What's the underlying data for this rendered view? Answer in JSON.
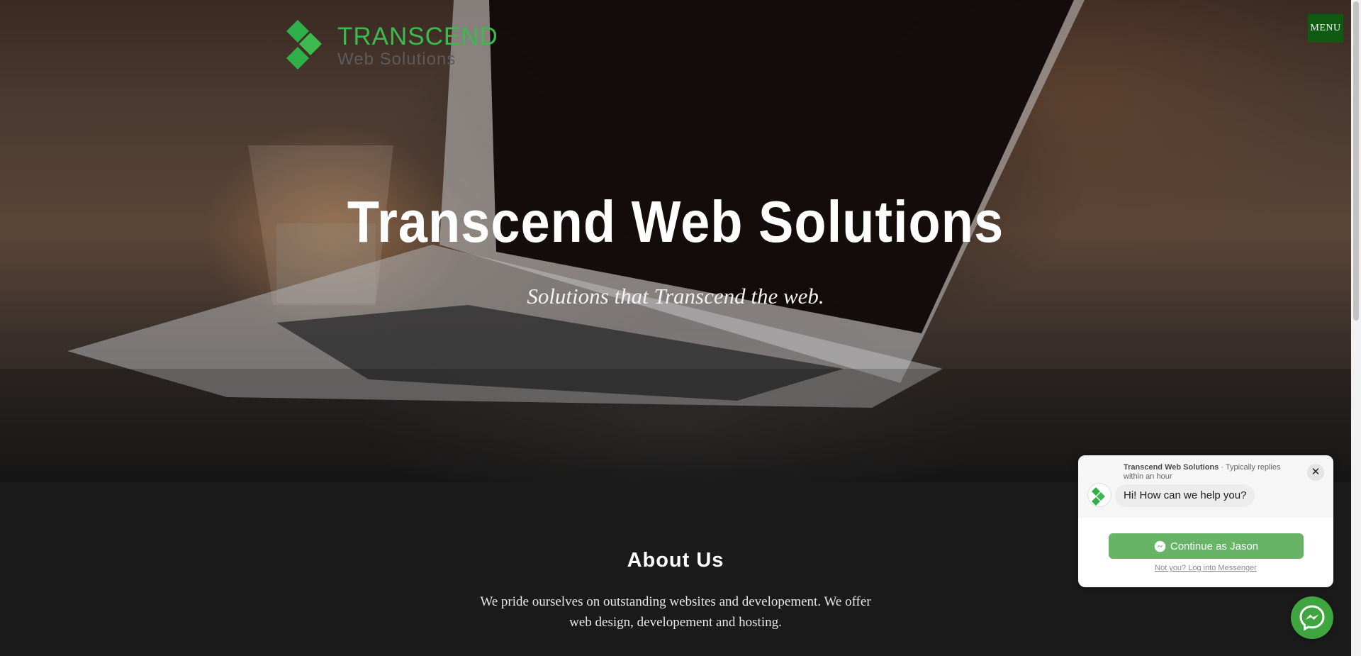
{
  "header": {
    "logo_text_top": "TRANSCEND",
    "logo_text_bottom": "Web Solutions",
    "menu_label": "MENU"
  },
  "hero": {
    "title": "Transcend Web Solutions",
    "subtitle": "Solutions that Transcend the web."
  },
  "about": {
    "title": "About Us",
    "text": "We pride ourselves on outstanding websites and developement. We offer web design, developement and hosting."
  },
  "chat_widget": {
    "page_name": "Transcend Web Solutions",
    "reply_time": " · Typically replies within an hour",
    "greeting": "Hi! How can we help you?",
    "continue_label": "Continue as Jason",
    "alt_login": "Not you? Log into Messenger",
    "close_label": "✕"
  },
  "colors": {
    "brand_green": "#3dba4e",
    "menu_bg": "#0f5a11",
    "continue_button": "#67b467",
    "messenger_fab": "#3fa63f",
    "page_bg": "#1b1b1b"
  },
  "icons": [
    "logo-diamond-icon",
    "messenger-icon",
    "close-icon"
  ]
}
